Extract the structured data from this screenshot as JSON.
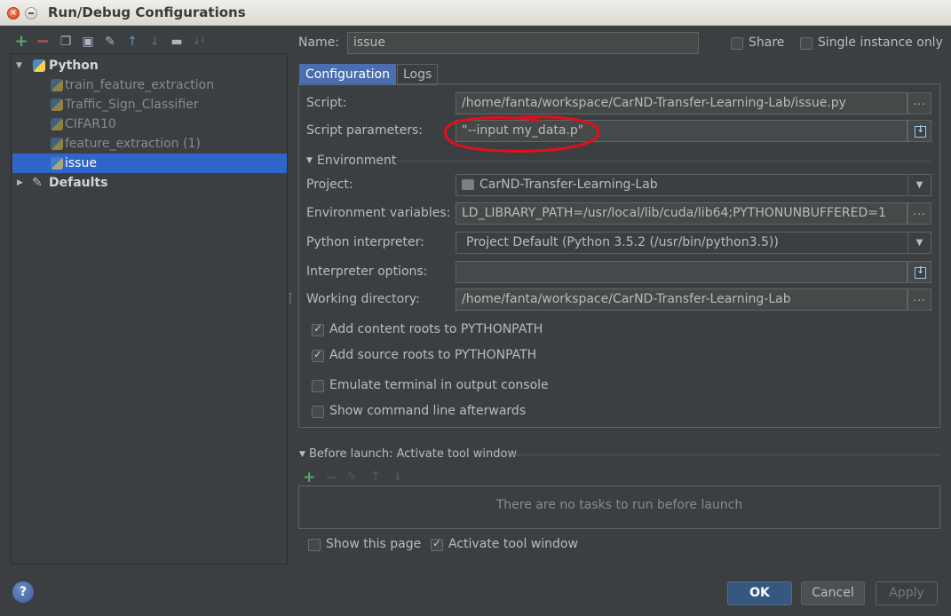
{
  "window": {
    "title": "Run/Debug Configurations"
  },
  "toolbar": {
    "icons": [
      "add-icon",
      "remove-icon",
      "copy-icon",
      "save-icon",
      "wrench-icon",
      "move-up-icon",
      "move-down-icon",
      "folder-icon",
      "sort-icon"
    ]
  },
  "tree": {
    "python_label": "Python",
    "items": [
      {
        "label": "train_feature_extraction"
      },
      {
        "label": "Traffic_Sign_Classifier"
      },
      {
        "label": "CIFAR10"
      },
      {
        "label": "feature_extraction (1)"
      },
      {
        "label": "issue"
      }
    ],
    "defaults_label": "Defaults"
  },
  "header": {
    "name_label": "Name:",
    "name_value": "issue",
    "share_label": "Share",
    "single_instance_label": "Single instance only"
  },
  "tabs": {
    "configuration": "Configuration",
    "logs": "Logs"
  },
  "config": {
    "script_label": "Script:",
    "script_value": "/home/fanta/workspace/CarND-Transfer-Learning-Lab/issue.py",
    "script_params_label": "Script parameters:",
    "script_params_value": "\"--input my_data.p\"",
    "environment_label": "Environment",
    "project_label": "Project:",
    "project_value": "CarND-Transfer-Learning-Lab",
    "env_vars_label": "Environment variables:",
    "env_vars_value": "LD_LIBRARY_PATH=/usr/local/lib/cuda/lib64;PYTHONUNBUFFERED=1",
    "interpreter_label": "Python interpreter:",
    "interpreter_value": "Project Default (Python 3.5.2 (/usr/bin/python3.5))",
    "interp_options_label": "Interpreter options:",
    "interp_options_value": "",
    "workdir_label": "Working directory:",
    "workdir_value": "/home/fanta/workspace/CarND-Transfer-Learning-Lab",
    "add_content_roots": "Add content roots to PYTHONPATH",
    "add_source_roots": "Add source roots to PYTHONPATH",
    "emulate_terminal": "Emulate terminal in output console",
    "show_cmdline": "Show command line afterwards"
  },
  "before_launch": {
    "label": "Before launch: Activate tool window",
    "empty_text": "There are no tasks to run before launch",
    "show_page": "Show this page",
    "activate_tool_window": "Activate tool window"
  },
  "buttons": {
    "ok": "OK",
    "cancel": "Cancel",
    "apply": "Apply"
  },
  "annotation_color": "#e0101a"
}
